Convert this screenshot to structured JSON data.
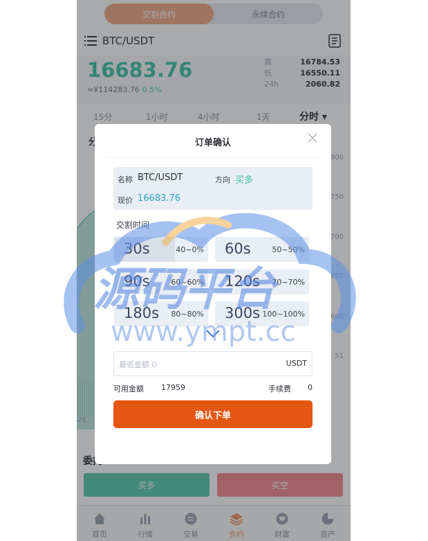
{
  "tabs": {
    "delivery": "交割合约",
    "perpetual": "永续合约"
  },
  "header": {
    "pair": "BTC/USDT"
  },
  "ticker": {
    "price": "16683.76",
    "cny": "≈¥114283.76",
    "change": "0.5%",
    "high_label": "高",
    "high": "16784.53",
    "low_label": "低",
    "low": "16550.11",
    "vol_label": "24h",
    "vol": "2060.82"
  },
  "periods": {
    "p15": "15分",
    "p1h": "1小时",
    "p4h": "4小时",
    "p1d": "1天",
    "selected": "分时 ▾",
    "fen": "分"
  },
  "axis": [
    "800",
    "750",
    "700",
    "650",
    "600",
    "51",
    "26"
  ],
  "entrust_title": "委托",
  "actions": {
    "buy": "买多",
    "sell": "买空"
  },
  "tabbar": [
    {
      "label": "首页"
    },
    {
      "label": "行情"
    },
    {
      "label": "交易"
    },
    {
      "label": "合约"
    },
    {
      "label": "财富"
    },
    {
      "label": "资产"
    }
  ],
  "modal": {
    "title": "订单确认",
    "name_label": "名称",
    "name_value": "BTC/USDT",
    "direction_label": "方向",
    "direction_value": "买多",
    "current_label": "现价",
    "current_value": "16683.76",
    "section_label": "交割时间",
    "options": [
      {
        "time": "30s",
        "rate": "40~0%"
      },
      {
        "time": "60s",
        "rate": "50~50%"
      },
      {
        "time": "90s",
        "rate": "60~60%"
      },
      {
        "time": "120s",
        "rate": "70~70%"
      },
      {
        "time": "180s",
        "rate": "80~80%"
      },
      {
        "time": "300s",
        "rate": "100~100%"
      }
    ],
    "amount_placeholder": "最低金额 0",
    "amount_unit": "USDT",
    "available_label": "可用金额",
    "available_value": "17959",
    "fee_label": "手续费",
    "fee_value": "0",
    "confirm": "确认下单"
  },
  "watermark": {
    "text": "源码平台",
    "url": "www.ympt.cc"
  },
  "colors": {
    "accent": "#e55612",
    "green": "#3ec2a6",
    "tab_active": "#efa783",
    "sell": "#f0878a"
  }
}
